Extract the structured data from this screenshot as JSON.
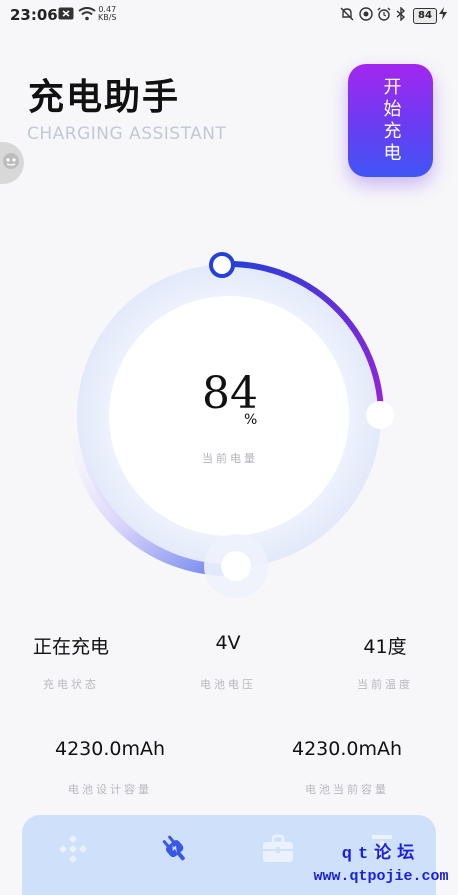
{
  "status_bar": {
    "time": "23:06",
    "net_speed": "0.47",
    "net_unit": "KB/S",
    "battery_level": "84"
  },
  "header": {
    "title": "充电助手",
    "subtitle": "CHARGING ASSISTANT",
    "start_button": "开始充电"
  },
  "gauge": {
    "value": "84",
    "unit": "%",
    "label": "当前电量",
    "level": 0.84
  },
  "stats": {
    "charge_status_value": "正在充电",
    "charge_status_label": "充电状态",
    "voltage_value": "4V",
    "voltage_label": "电池电压",
    "temperature_value": "41度",
    "temperature_label": "当前温度",
    "design_capacity_value": "4230.0mAh",
    "design_capacity_label": "电池设计容量",
    "current_capacity_value": "4230.0mAh",
    "current_capacity_label": "电池当前容量"
  },
  "nav": {
    "items": [
      "grid-icon",
      "plug-icon",
      "toolbox-icon",
      "download-icon"
    ],
    "active": "plug-icon",
    "active_color": "#3a58e8",
    "inactive_color": "#e9f1fe"
  },
  "watermark": {
    "line1": "qt论坛",
    "line2": "www.qtpojie.com"
  }
}
